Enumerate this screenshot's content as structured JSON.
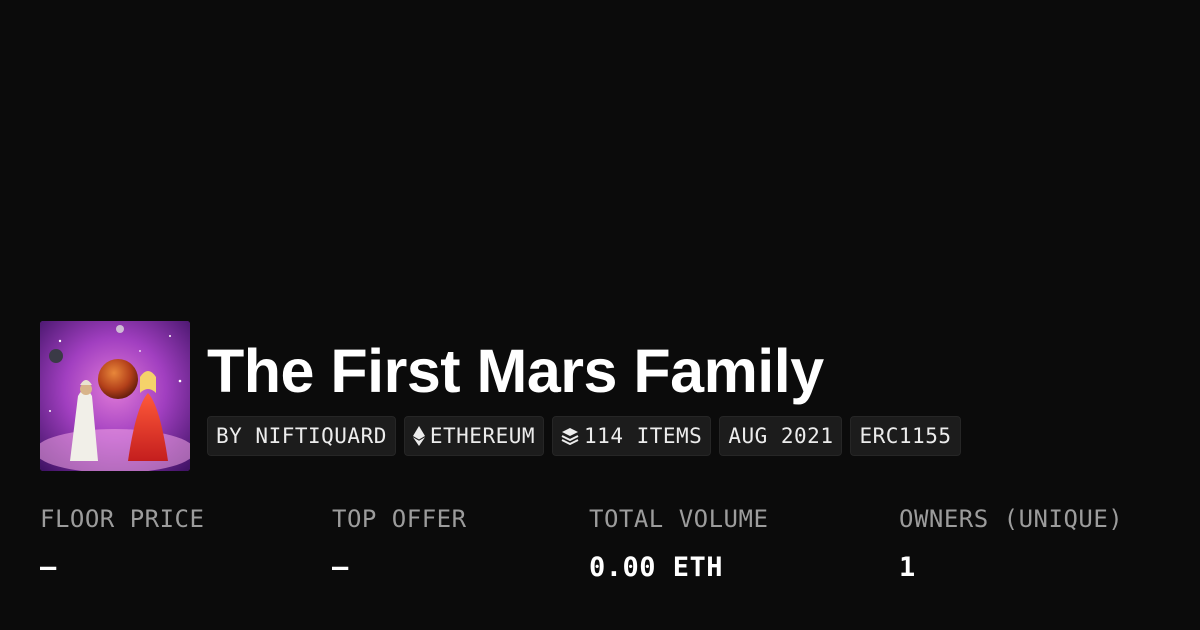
{
  "collection": {
    "title": "The First Mars Family",
    "avatar_icon": "collection-artwork-image"
  },
  "chips": {
    "creator": "BY NIFTIQUARD",
    "chain": "ETHEREUM",
    "chain_icon": "ethereum-icon",
    "items": "114 ITEMS",
    "items_icon": "layers-icon",
    "date": "AUG 2021",
    "standard": "ERC1155"
  },
  "stats": {
    "floor_price": {
      "label": "FLOOR PRICE",
      "value": "–"
    },
    "top_offer": {
      "label": "TOP OFFER",
      "value": "–"
    },
    "total_volume": {
      "label": "TOTAL VOLUME",
      "value": "0.00 ETH"
    },
    "owners": {
      "label": "OWNERS (UNIQUE)",
      "value": "1"
    }
  },
  "colors": {
    "background": "#0b0b0b",
    "chip_background": "#1c1c1c",
    "label_gray": "#9c9c9c",
    "text_white": "#ffffff"
  }
}
